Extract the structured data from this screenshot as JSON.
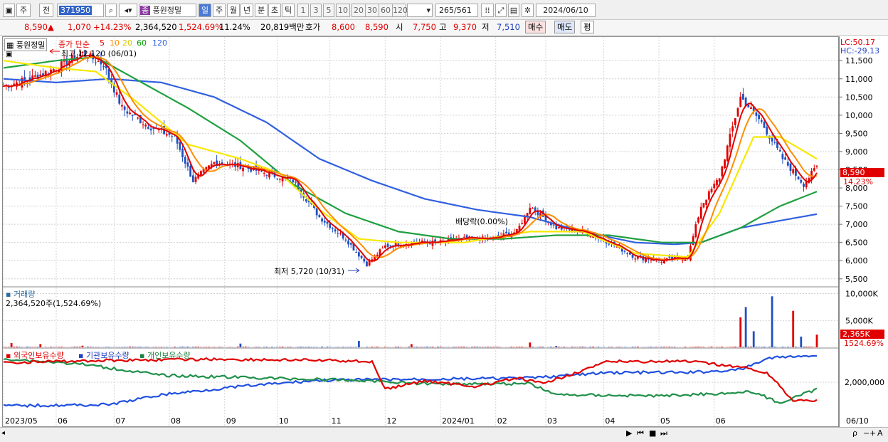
{
  "toolbar": {
    "mode1": "주",
    "mode2": "전",
    "code": "371950",
    "name": "풍원정밀",
    "badge": "종",
    "periods": [
      "일",
      "주",
      "월",
      "년",
      "분",
      "초",
      "틱"
    ],
    "ticks": [
      "1",
      "3",
      "5",
      "10",
      "20",
      "30",
      "60",
      "120"
    ],
    "count": "265",
    "total": "/561",
    "date": "2024/06/10"
  },
  "quote": {
    "price": "8,590",
    "arrow": "▲",
    "change": "1,070",
    "pct": "+14.23%",
    "volume": "2,364,520",
    "vol_pct": "1,524.69%",
    "turnover": "11.24%",
    "amount": "20,819백만",
    "hoga_label": "호가",
    "hoga": "8,600",
    "hoga2": "8,590",
    "open_label": "시",
    "open": "7,750",
    "high_label": "고",
    "high": "9,370",
    "low_label": "저",
    "low": "7,510",
    "buy": "매수",
    "sell": "매도",
    "eval": "평"
  },
  "legend": {
    "name": "풍원정밀",
    "ma_title": "종가 단순",
    "ma": [
      "5",
      "10",
      "20",
      "60",
      "120"
    ],
    "ma_colors": [
      "#e00000",
      "#ff8c00",
      "#f0e000",
      "#00a000",
      "#3060e0"
    ]
  },
  "annotations": {
    "high": "최고 12,120 (06/01)",
    "low": "최저 5,720 (10/31)",
    "dividend": "배당락(0.00%)"
  },
  "right": {
    "lc": "LC:50.17",
    "hc": "HC:-29.13",
    "price_tag": "8,590",
    "pct_tag": "14.23%",
    "vol_tag": "2,365K",
    "vol_pct_tag": "1524.69%"
  },
  "vol_panel": {
    "title": "거래량",
    "value": "2,364,520주(1,524.69%)"
  },
  "holders": {
    "foreign": "외국인보유수량",
    "inst": "기관보유수량",
    "indiv": "개인보유수량",
    "tick": "2,000,000"
  },
  "chart_data": {
    "type": "candlestick",
    "price_axis": [
      5500,
      6000,
      6500,
      7000,
      7500,
      8000,
      8500,
      9000,
      9500,
      10000,
      10500,
      11000,
      11500
    ],
    "volume_axis": [
      "5,000K",
      "10,000K"
    ],
    "x_labels": [
      "2023/05",
      "06",
      "07",
      "08",
      "09",
      "10",
      "11",
      "12",
      "2024/01",
      "02",
      "03",
      "04",
      "05",
      "06",
      "06/10"
    ],
    "close_anchors": [
      [
        0,
        10800
      ],
      [
        10,
        11000
      ],
      [
        20,
        11300
      ],
      [
        30,
        11700
      ],
      [
        38,
        11400
      ],
      [
        45,
        10200
      ],
      [
        55,
        9700
      ],
      [
        65,
        9400
      ],
      [
        72,
        8200
      ],
      [
        80,
        8700
      ],
      [
        90,
        8600
      ],
      [
        100,
        8400
      ],
      [
        110,
        8200
      ],
      [
        120,
        7200
      ],
      [
        130,
        6600
      ],
      [
        138,
        5900
      ],
      [
        145,
        6400
      ],
      [
        155,
        6500
      ],
      [
        165,
        6500
      ],
      [
        175,
        6600
      ],
      [
        185,
        6600
      ],
      [
        195,
        6800
      ],
      [
        200,
        7500
      ],
      [
        210,
        6900
      ],
      [
        220,
        6800
      ],
      [
        230,
        6500
      ],
      [
        240,
        6100
      ],
      [
        250,
        6000
      ],
      [
        260,
        6100
      ],
      [
        265,
        7500
      ],
      [
        272,
        8300
      ],
      [
        280,
        10500
      ],
      [
        288,
        9800
      ],
      [
        296,
        8800
      ],
      [
        304,
        8100
      ],
      [
        309,
        8590
      ]
    ],
    "ma20_anchors": [
      [
        0,
        11500
      ],
      [
        20,
        11300
      ],
      [
        35,
        11200
      ],
      [
        50,
        10400
      ],
      [
        70,
        9200
      ],
      [
        90,
        8800
      ],
      [
        105,
        8400
      ],
      [
        120,
        7400
      ],
      [
        135,
        6600
      ],
      [
        150,
        6500
      ],
      [
        175,
        6500
      ],
      [
        200,
        6800
      ],
      [
        220,
        6800
      ],
      [
        240,
        6200
      ],
      [
        260,
        6100
      ],
      [
        272,
        7300
      ],
      [
        285,
        9400
      ],
      [
        295,
        9400
      ],
      [
        309,
        8800
      ]
    ],
    "ma60_anchors": [
      [
        0,
        11300
      ],
      [
        20,
        11500
      ],
      [
        35,
        11600
      ],
      [
        50,
        11000
      ],
      [
        70,
        10200
      ],
      [
        90,
        9300
      ],
      [
        110,
        8100
      ],
      [
        130,
        7300
      ],
      [
        150,
        6800
      ],
      [
        170,
        6600
      ],
      [
        190,
        6600
      ],
      [
        210,
        6700
      ],
      [
        230,
        6700
      ],
      [
        250,
        6500
      ],
      [
        265,
        6500
      ],
      [
        280,
        6900
      ],
      [
        295,
        7500
      ],
      [
        309,
        7900
      ]
    ],
    "ma120_anchors": [
      [
        0,
        11000
      ],
      [
        20,
        10900
      ],
      [
        40,
        11000
      ],
      [
        60,
        10900
      ],
      [
        80,
        10500
      ],
      [
        100,
        9800
      ],
      [
        120,
        8800
      ],
      [
        140,
        8200
      ],
      [
        160,
        7700
      ],
      [
        180,
        7400
      ],
      [
        200,
        7200
      ],
      [
        220,
        6800
      ],
      [
        240,
        6500
      ],
      [
        255,
        6450
      ],
      [
        265,
        6500
      ],
      [
        280,
        6900
      ],
      [
        295,
        7100
      ],
      [
        309,
        7280
      ]
    ],
    "holders": {
      "foreign_anchors": [
        [
          0,
          0.12
        ],
        [
          20,
          0.1
        ],
        [
          40,
          0.08
        ],
        [
          80,
          0.06
        ],
        [
          120,
          0.08
        ],
        [
          140,
          0.1
        ],
        [
          145,
          0.6
        ],
        [
          160,
          0.45
        ],
        [
          180,
          0.55
        ],
        [
          195,
          0.4
        ],
        [
          205,
          0.5
        ],
        [
          230,
          0.1
        ],
        [
          260,
          0.1
        ],
        [
          280,
          0.2
        ],
        [
          290,
          0.3
        ],
        [
          300,
          0.8
        ],
        [
          309,
          0.8
        ]
      ],
      "inst_anchors": [
        [
          0,
          0.9
        ],
        [
          40,
          0.88
        ],
        [
          60,
          0.7
        ],
        [
          90,
          0.55
        ],
        [
          120,
          0.44
        ],
        [
          160,
          0.42
        ],
        [
          200,
          0.4
        ],
        [
          230,
          0.3
        ],
        [
          260,
          0.3
        ],
        [
          280,
          0.25
        ],
        [
          290,
          0.05
        ],
        [
          300,
          0.0
        ],
        [
          309,
          0.0
        ]
      ],
      "indiv_anchors": [
        [
          0,
          0.05
        ],
        [
          30,
          0.15
        ],
        [
          60,
          0.35
        ],
        [
          100,
          0.4
        ],
        [
          140,
          0.45
        ],
        [
          160,
          0.5
        ],
        [
          200,
          0.5
        ],
        [
          210,
          0.7
        ],
        [
          250,
          0.72
        ],
        [
          285,
          0.65
        ],
        [
          295,
          0.85
        ],
        [
          309,
          0.6
        ]
      ]
    }
  }
}
